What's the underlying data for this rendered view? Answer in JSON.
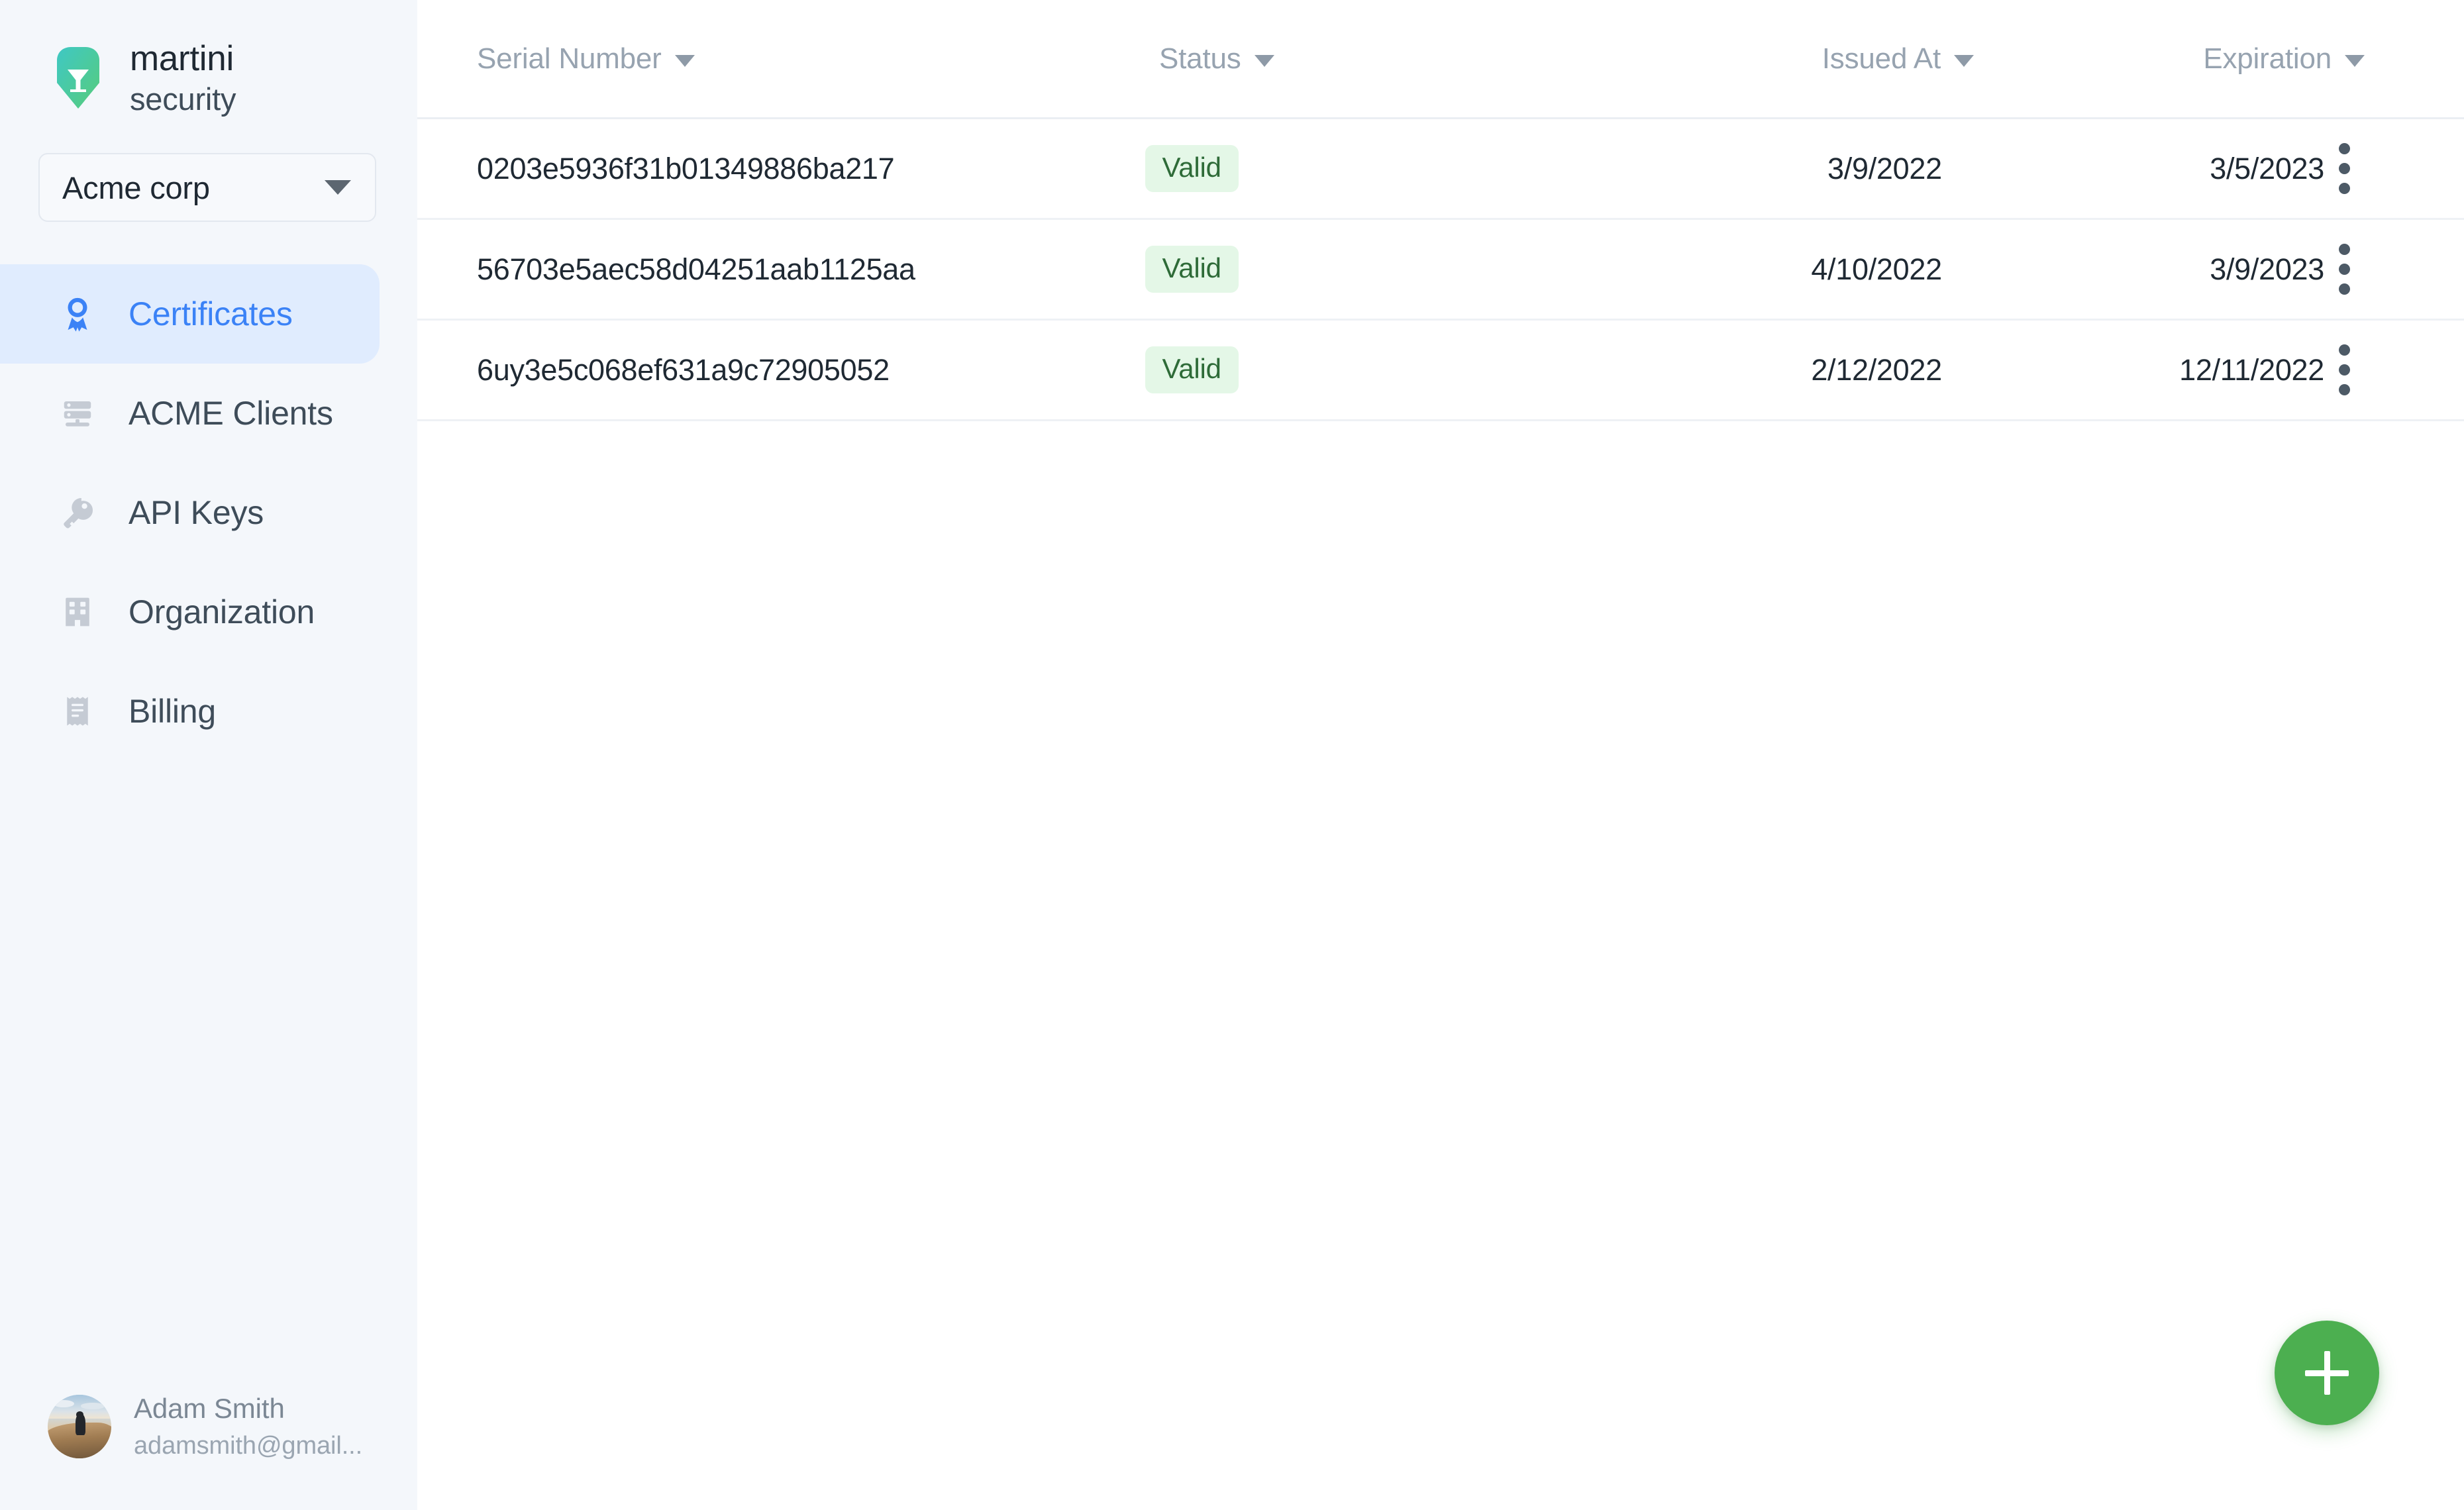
{
  "brand": {
    "name": "martini",
    "tagline": "security",
    "logo_icon": "martini-glass-shield-logo",
    "logo_gradient_from": "#43c6c0",
    "logo_gradient_to": "#52c878"
  },
  "org_selector": {
    "selected": "Acme corp",
    "caret_icon": "chevron-down-icon"
  },
  "sidebar": {
    "items": [
      {
        "label": "Certificates",
        "icon": "certificate-ribbon-icon",
        "active": true
      },
      {
        "label": "ACME Clients",
        "icon": "server-rack-icon",
        "active": false
      },
      {
        "label": "API Keys",
        "icon": "key-icon",
        "active": false
      },
      {
        "label": "Organization",
        "icon": "building-icon",
        "active": false
      },
      {
        "label": "Billing",
        "icon": "receipt-icon",
        "active": false
      }
    ],
    "active_color": "#3b82f6",
    "active_bg": "#e0ecfe",
    "background": "#f4f7fb"
  },
  "user": {
    "name": "Adam Smith",
    "email": "adamsmith@gmail...",
    "avatar_icon": "user-avatar-photo"
  },
  "table": {
    "columns": [
      {
        "label": "Serial Number",
        "sort_icon": "sort-caret-down-icon"
      },
      {
        "label": "Status",
        "sort_icon": "sort-caret-down-icon"
      },
      {
        "label": "Issued At",
        "sort_icon": "sort-caret-down-icon"
      },
      {
        "label": "Expiration",
        "sort_icon": "sort-caret-down-icon"
      }
    ],
    "rows": [
      {
        "serial": "0203e5936f31b01349886ba217",
        "status": "Valid",
        "issued_at": "3/9/2022",
        "expiration": "3/5/2023",
        "menu_icon": "kebab-menu-icon"
      },
      {
        "serial": "56703e5aec58d04251aab1125aa",
        "status": "Valid",
        "issued_at": "4/10/2022",
        "expiration": "3/9/2023",
        "menu_icon": "kebab-menu-icon"
      },
      {
        "serial": "6uy3e5c068ef631a9c72905052",
        "status": "Valid",
        "issued_at": "2/12/2022",
        "expiration": "12/11/2022",
        "menu_icon": "kebab-menu-icon"
      }
    ],
    "status_badge_bg": "#e4f7e7",
    "status_badge_color": "#2e6b38"
  },
  "fab": {
    "icon": "plus-icon",
    "color": "#4caf50",
    "label": "Add certificate"
  }
}
